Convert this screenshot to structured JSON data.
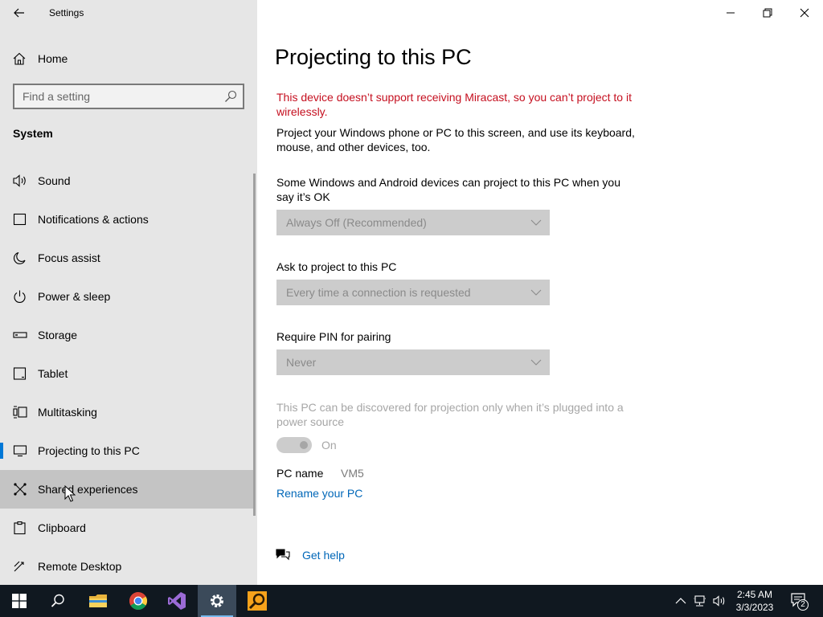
{
  "app": {
    "title": "Settings"
  },
  "sidebar": {
    "home_label": "Home",
    "search_placeholder": "Find a setting",
    "section_title": "System",
    "items": [
      {
        "label": "Sound",
        "icon": "speaker-icon"
      },
      {
        "label": "Notifications & actions",
        "icon": "notifications-icon"
      },
      {
        "label": "Focus assist",
        "icon": "moon-icon"
      },
      {
        "label": "Power & sleep",
        "icon": "power-icon"
      },
      {
        "label": "Storage",
        "icon": "storage-icon"
      },
      {
        "label": "Tablet",
        "icon": "tablet-icon"
      },
      {
        "label": "Multitasking",
        "icon": "multitasking-icon"
      },
      {
        "label": "Projecting to this PC",
        "icon": "projecting-icon",
        "selected": true
      },
      {
        "label": "Shared experiences",
        "icon": "shared-experiences-icon",
        "hover": true
      },
      {
        "label": "Clipboard",
        "icon": "clipboard-icon"
      },
      {
        "label": "Remote Desktop",
        "icon": "remote-desktop-icon"
      }
    ]
  },
  "main": {
    "title": "Projecting to this PC",
    "warning": "This device doesn’t support receiving Miracast, so you can’t project to it wirelessly.",
    "description": "Project your Windows phone or PC to this screen, and use its keyboard, mouse, and other devices, too.",
    "setting1_label": "Some Windows and Android devices can project to this PC when you say it’s OK",
    "setting1_value": "Always Off (Recommended)",
    "setting2_label": "Ask to project to this PC",
    "setting2_value": "Every time a connection is requested",
    "setting3_label": "Require PIN for pairing",
    "setting3_value": "Never",
    "plugged_text": "This PC can be discovered for projection only when it’s plugged into a power source",
    "toggle_state": "On",
    "pc_name_label": "PC name",
    "pc_name_value": "VM5",
    "rename_link": "Rename your PC",
    "help_link": "Get help"
  },
  "taskbar": {
    "time": "2:45 AM",
    "date": "3/3/2023",
    "notification_count": "2",
    "apps": [
      "start-icon",
      "search-icon",
      "file-explorer-icon",
      "chrome-icon",
      "visual-studio-icon",
      "settings-icon",
      "magnifier-app-icon"
    ]
  },
  "colors": {
    "accent": "#0078d7",
    "warning": "#c50f1f",
    "link": "#0067b8",
    "sidebar_bg": "#e6e6e6",
    "taskbar_bg": "#101820"
  }
}
